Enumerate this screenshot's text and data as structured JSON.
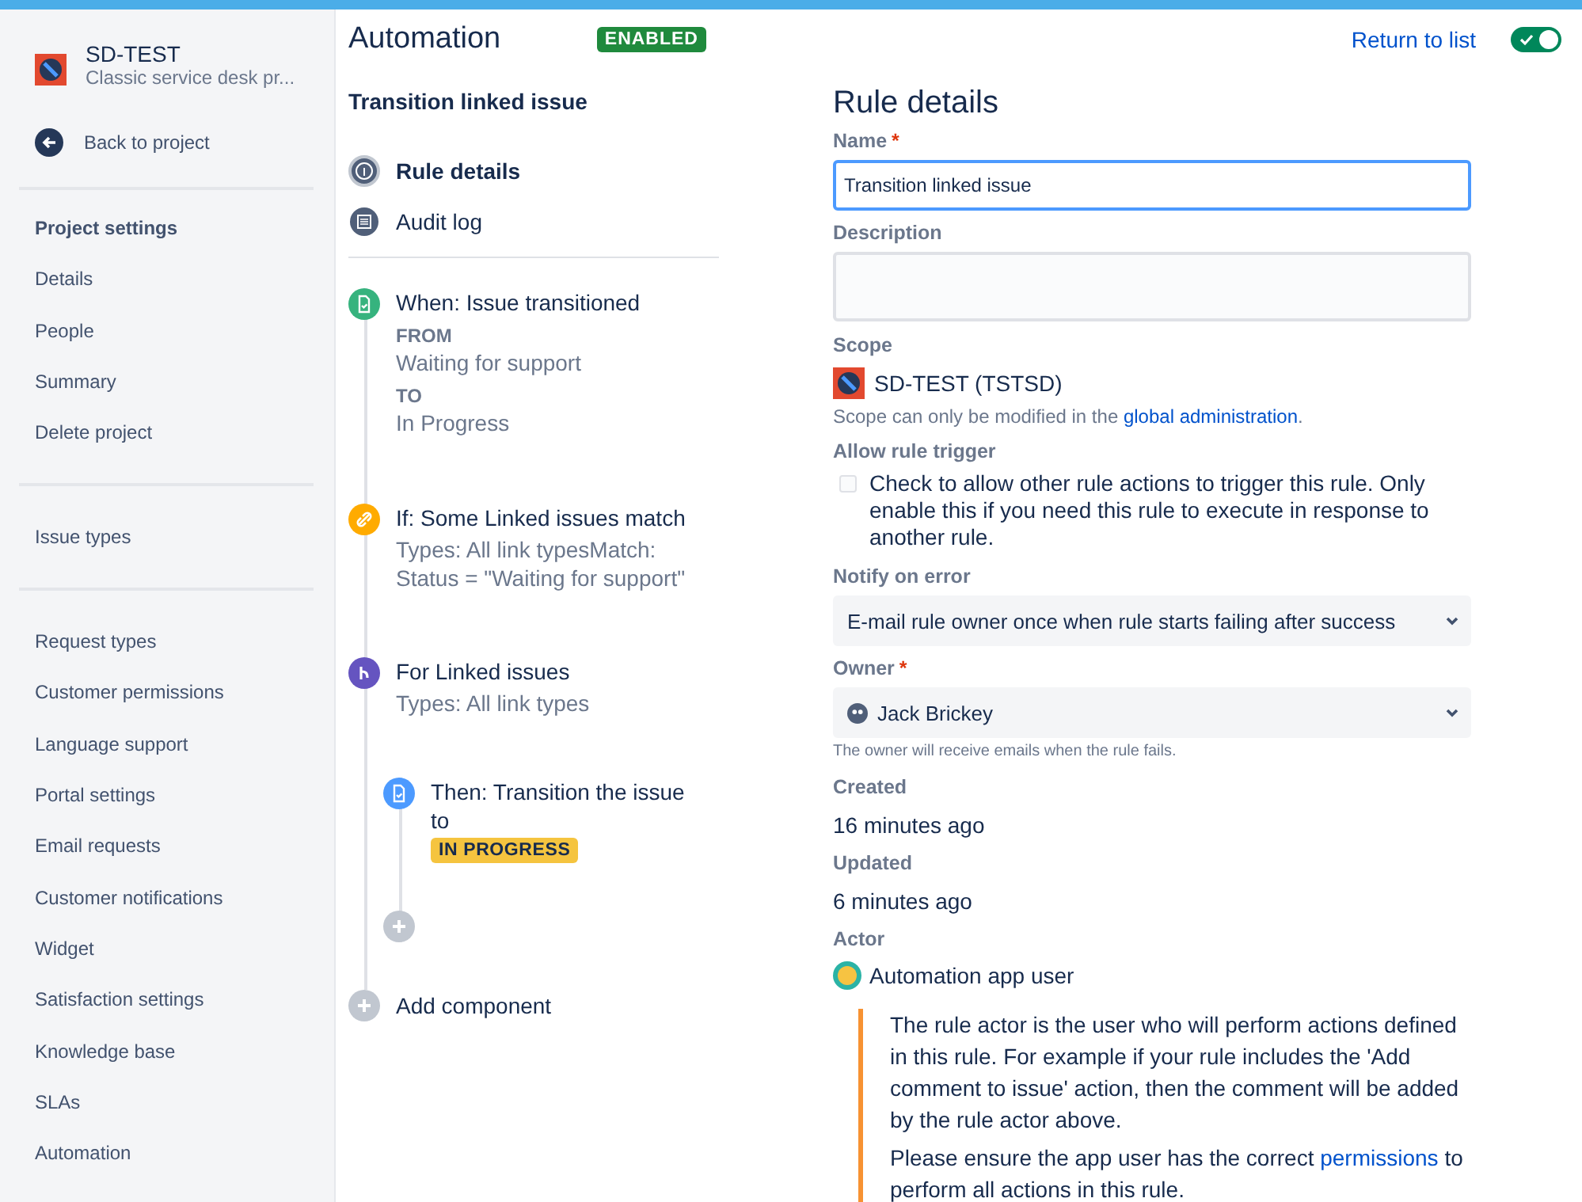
{
  "sidebar": {
    "project_name": "SD-TEST",
    "project_type": "Classic service desk pr...",
    "back_link": "Back to project",
    "sections": [
      {
        "heading": "Project settings",
        "items": [
          "Details",
          "People",
          "Summary",
          "Delete project"
        ]
      },
      {
        "items": [
          "Issue types"
        ]
      },
      {
        "items": [
          "Request types",
          "Customer permissions",
          "Language support",
          "Portal settings",
          "Email requests",
          "Customer notifications",
          "Widget",
          "Satisfaction settings",
          "Knowledge base",
          "SLAs",
          "Automation"
        ]
      }
    ]
  },
  "header": {
    "title": "Automation",
    "status_badge": "ENABLED",
    "return_link": "Return to list",
    "rule_enabled": true
  },
  "rule": {
    "name": "Transition linked issue",
    "nav": [
      {
        "label": "Rule details",
        "kind": "info",
        "selected": true
      },
      {
        "label": "Audit log",
        "kind": "log",
        "selected": false
      }
    ],
    "steps": [
      {
        "kind": "trigger",
        "title": "When: Issue transitioned",
        "details": [
          {
            "label": "FROM",
            "value": "Waiting for support"
          },
          {
            "label": "TO",
            "value": "In Progress"
          }
        ]
      },
      {
        "kind": "condition",
        "title": "If: Some Linked issues match",
        "description": "Types: All link typesMatch: Status = \"Waiting for support\""
      },
      {
        "kind": "branch",
        "title": "For Linked issues",
        "description": "Types: All link types",
        "children": [
          {
            "kind": "action",
            "title": "Then: Transition the issue to",
            "status": "IN PROGRESS"
          }
        ]
      }
    ],
    "add_component": "Add component"
  },
  "details": {
    "heading": "Rule details",
    "name": {
      "label": "Name",
      "required_mark": "*",
      "value": "Transition linked issue"
    },
    "description": {
      "label": "Description"
    },
    "scope": {
      "label": "Scope",
      "value": "SD-TEST (TSTSD)",
      "note": "Scope can only be modified in the ",
      "note_link": "global administration",
      "note_end": "."
    },
    "allow_rule_trigger": {
      "label": "Allow rule trigger",
      "checked": false,
      "text": "Check to allow other rule actions to trigger this rule. Only enable this if you need this rule to execute in response to another rule."
    },
    "notify_on_error": {
      "label": "Notify on error",
      "value": "E-mail rule owner once when rule starts failing after success"
    },
    "owner": {
      "label": "Owner",
      "required_mark": "*",
      "value": "Jack Brickey",
      "hint": "The owner will receive emails when the rule fails."
    },
    "created": {
      "label": "Created",
      "value": "16 minutes ago"
    },
    "updated": {
      "label": "Updated",
      "value": "6 minutes ago"
    },
    "actor": {
      "label": "Actor",
      "value": "Automation app user",
      "note": "The rule actor is the user who will perform actions defined in this rule. For example if your rule includes the 'Add comment to issue' action, then the comment will be added by the rule actor above.",
      "note_2": "Please ensure the app user has the correct ",
      "note_2_link": "permissions",
      "note_2_end": " to perform all actions in this rule."
    }
  }
}
